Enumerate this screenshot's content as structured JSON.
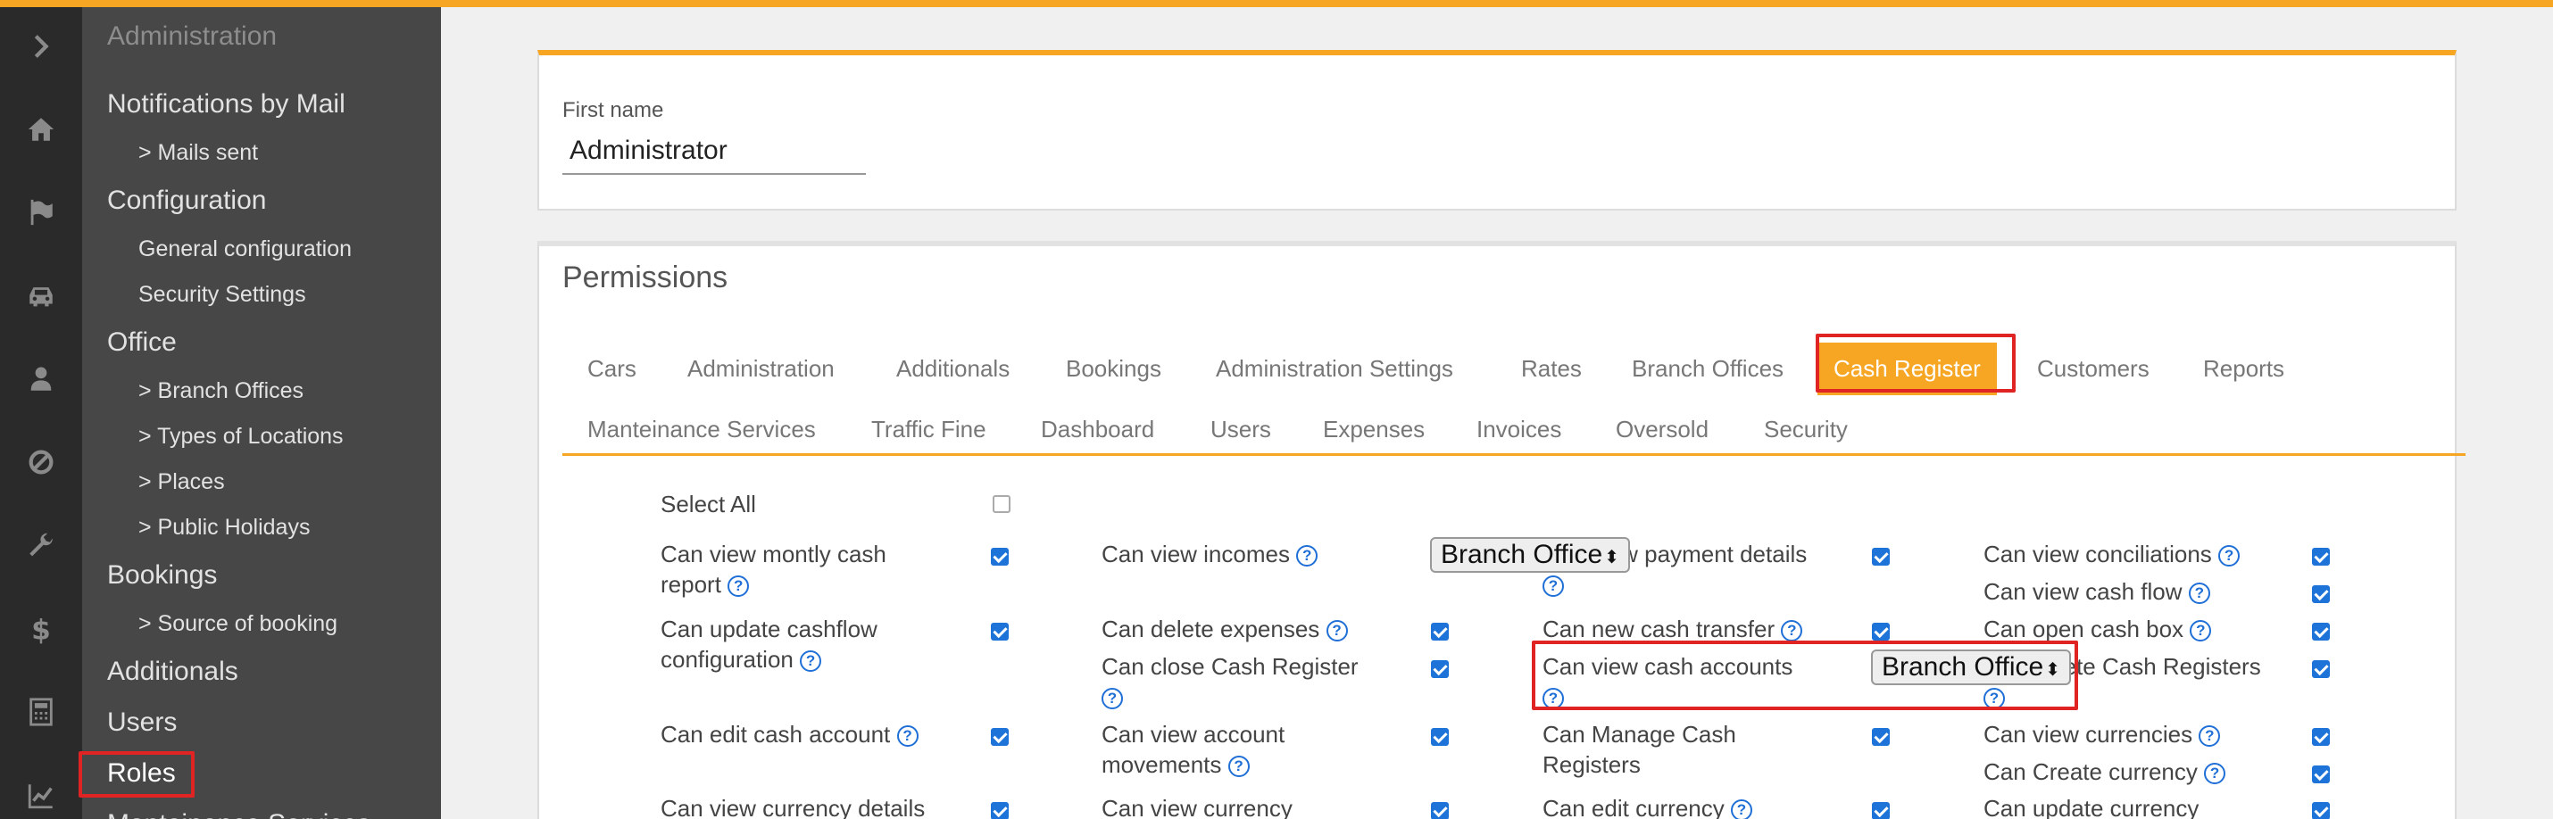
{
  "rail": {
    "icons": [
      "chevron-right-icon",
      "home-icon",
      "flag-icon",
      "car-icon",
      "user-icon",
      "ban-icon",
      "wrench-icon",
      "dollar-icon",
      "calculator-icon",
      "chart-icon"
    ]
  },
  "nav": {
    "administration": "Administration",
    "notifications": "Notifications by Mail",
    "mails_sent": "> Mails sent",
    "configuration": "Configuration",
    "general_config": "General configuration",
    "security_settings": "Security Settings",
    "office": "Office",
    "branch_offices": "> Branch Offices",
    "types_locations": "> Types of Locations",
    "places": "> Places",
    "public_holidays": "> Public Holidays",
    "bookings": "Bookings",
    "source_booking": "> Source of booking",
    "additionals": "Additionals",
    "users": "Users",
    "roles": "Roles",
    "maintenance": "Manteinance Services"
  },
  "form": {
    "first_name_label": "First name",
    "first_name_value": "Administrator"
  },
  "permissions": {
    "title": "Permissions",
    "tabs": [
      "Cars",
      "Administration",
      "Additionals",
      "Bookings",
      "Administration Settings",
      "Rates",
      "Branch Offices",
      "Cash Register",
      "Customers",
      "Reports",
      "Manteinance Services",
      "Traffic Fine",
      "Dashboard",
      "Users",
      "Expenses",
      "Invoices",
      "Oversold",
      "Security"
    ],
    "active_tab": "Cash Register",
    "select_all": "Select All",
    "col1": {
      "p1a": "Can view montly cash",
      "p1b": "report",
      "p2a": "Can update cashflow",
      "p2b": "configuration",
      "p3": "Can edit cash account",
      "p4": "Can view currency details"
    },
    "col2": {
      "p1": "Can view incomes",
      "p2": "Can delete expenses",
      "p3": "Can close Cash Register",
      "p4a": "Can view account",
      "p4b": "movements",
      "p5": "Can view currency"
    },
    "col3": {
      "dropdown1": "Branch Office",
      "p1": "Can view payment details",
      "p2": "Can new cash transfer",
      "p3": "Can view cash accounts",
      "p4a": "Can Manage Cash",
      "p4b": "Registers",
      "p5": "Can edit currency"
    },
    "col4": {
      "p1": "Can view conciliations",
      "p2": "Can view cash flow",
      "p3": "Can open cash box",
      "p4": "Can delete Cash Registers",
      "dropdown2": "Branch Office",
      "p5": "Can view currencies",
      "p6": "Can Create currency",
      "p7": "Can update currency"
    }
  },
  "colors": {
    "accent": "#f6a623",
    "highlight": "#e02424",
    "checkbox": "#1e73d8",
    "sidebar": "#474747",
    "rail": "#2a2a2a"
  }
}
